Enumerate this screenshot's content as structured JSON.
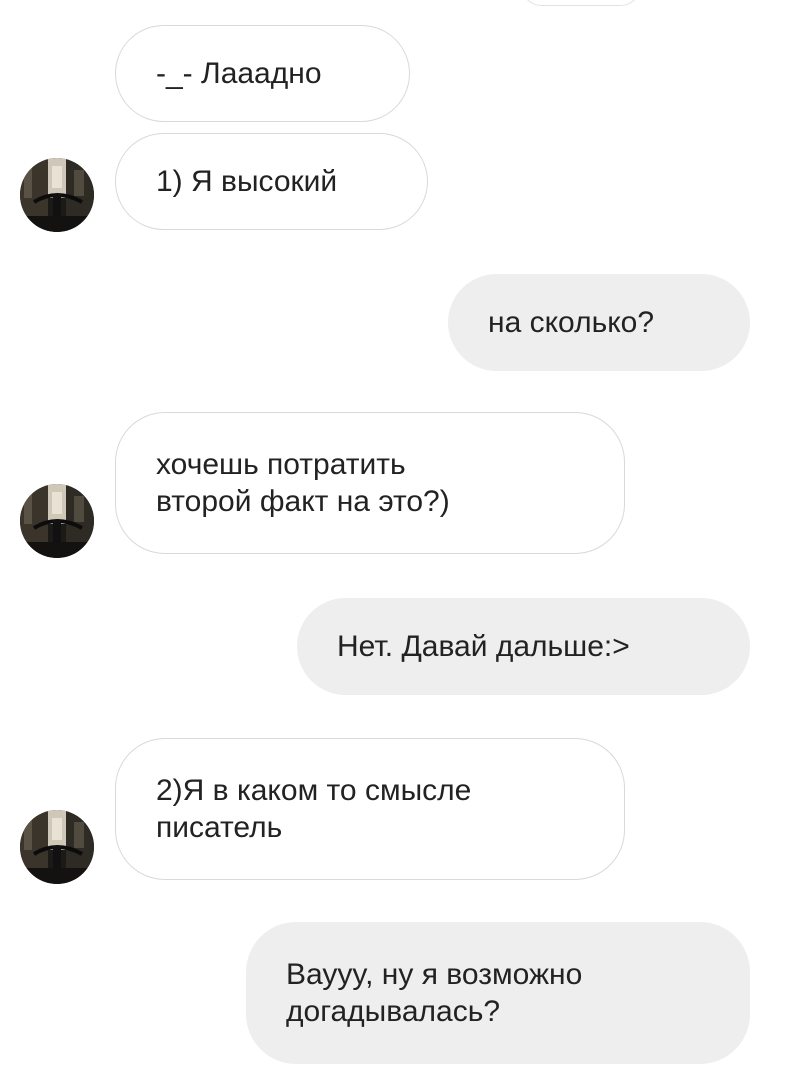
{
  "messages": [
    {
      "direction": "incoming",
      "text": "-_- Лааадно"
    },
    {
      "direction": "incoming",
      "text": "1) Я высокий"
    },
    {
      "direction": "outgoing",
      "text": "на сколько?"
    },
    {
      "direction": "incoming",
      "text": "хочешь потратить\nвторой факт на это?)"
    },
    {
      "direction": "outgoing",
      "text": "Нет. Давай дальше:>"
    },
    {
      "direction": "incoming",
      "text": "2)Я в каком то смысле\nписатель"
    },
    {
      "direction": "outgoing",
      "text": "Вауyy, ну я возможно\nдогадывалась?"
    }
  ],
  "colors": {
    "incoming_bg": "#ffffff",
    "incoming_border": "#d9d9d9",
    "outgoing_bg": "#eeeeee",
    "text": "#222222"
  },
  "icons": {
    "avatar": "avatar-photo-icon"
  }
}
